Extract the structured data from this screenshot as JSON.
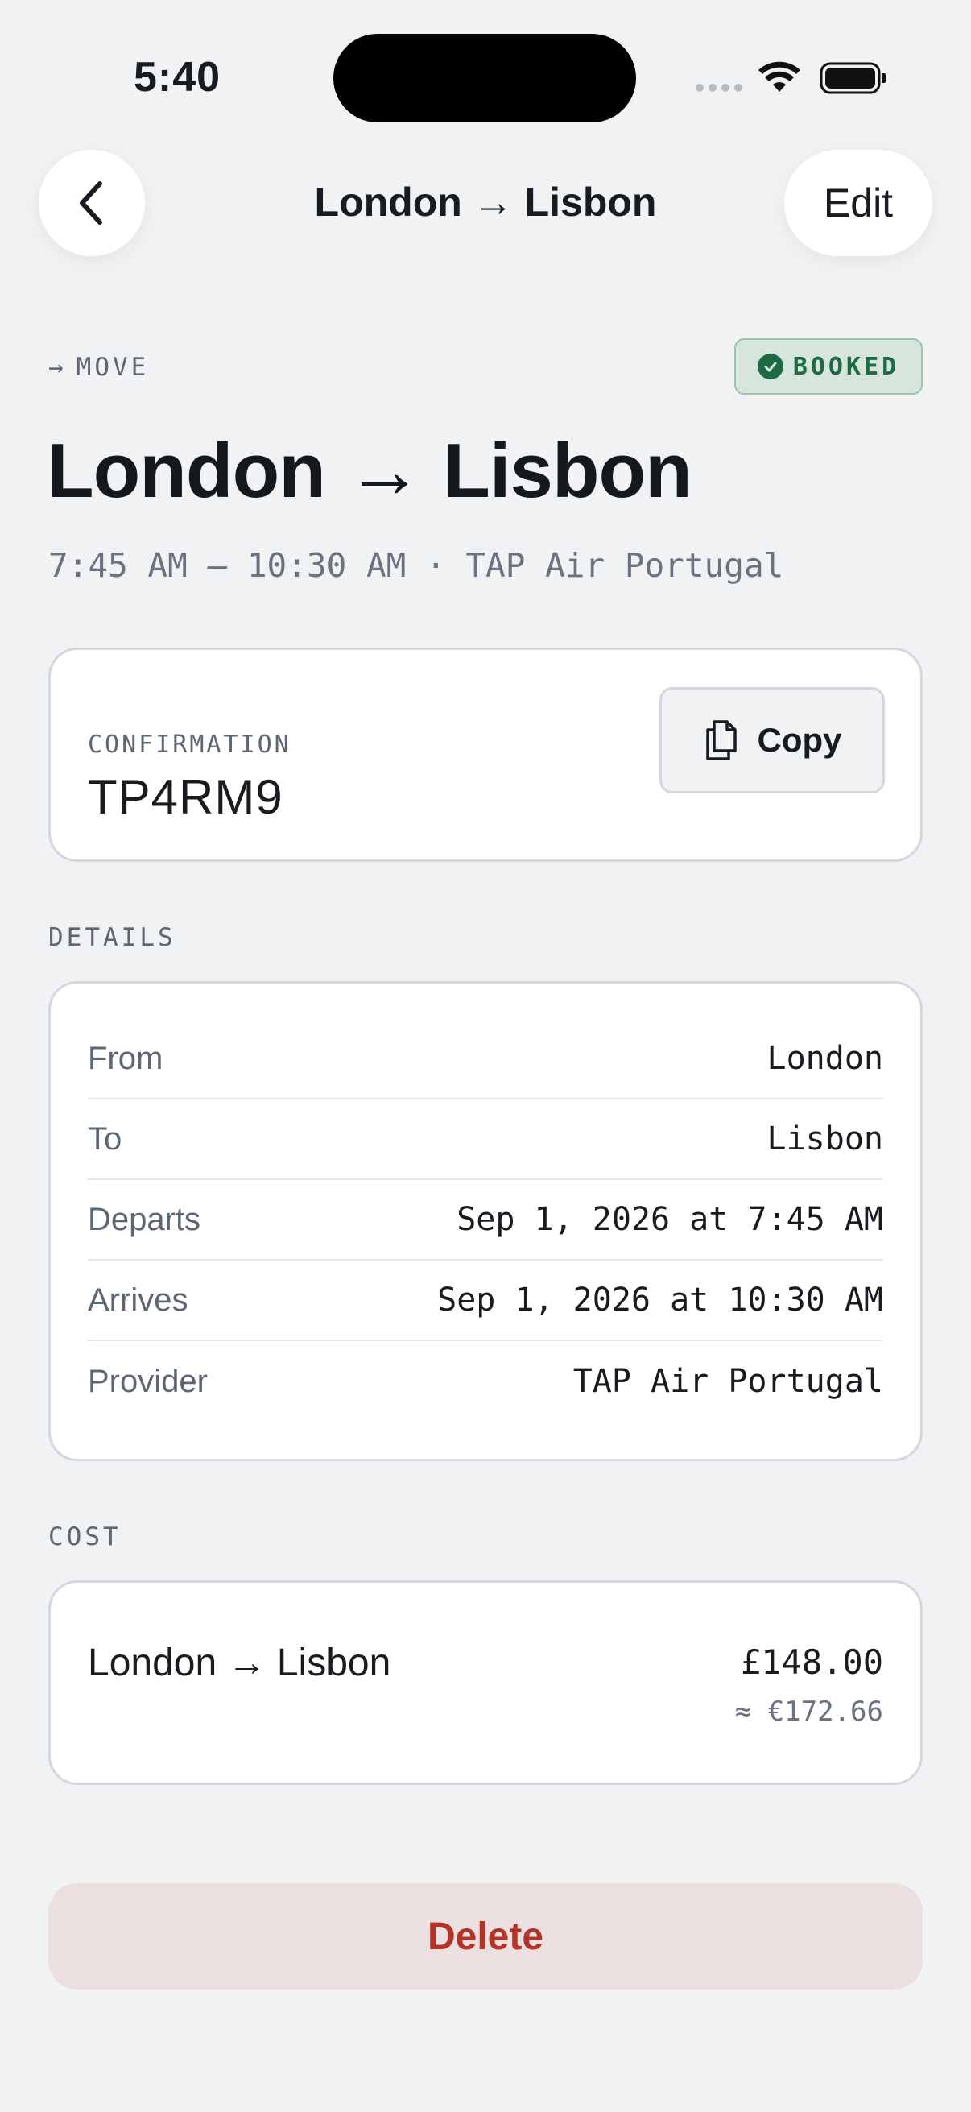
{
  "status_bar": {
    "time": "5:40"
  },
  "nav": {
    "title": "London → Lisbon",
    "edit_label": "Edit"
  },
  "header": {
    "kind_arrow": "→",
    "kind_label": "MOVE",
    "badge": "BOOKED",
    "title": "London → Lisbon",
    "subtitle": "7:45 AM — 10:30 AM · TAP Air Portugal"
  },
  "confirmation": {
    "label": "CONFIRMATION",
    "code": "TP4RM9",
    "copy_label": "Copy"
  },
  "details": {
    "section_label": "DETAILS",
    "rows": [
      {
        "label": "From",
        "value": "London"
      },
      {
        "label": "To",
        "value": "Lisbon"
      },
      {
        "label": "Departs",
        "value": "Sep 1, 2026 at 7:45 AM"
      },
      {
        "label": "Arrives",
        "value": "Sep 1, 2026 at 10:30 AM"
      },
      {
        "label": "Provider",
        "value": "TAP Air Portugal"
      }
    ]
  },
  "cost": {
    "section_label": "COST",
    "item_name": "London → Lisbon",
    "amount": "£148.00",
    "converted": "≈ €172.66"
  },
  "actions": {
    "delete_label": "Delete"
  },
  "colors": {
    "background": "#f1f2f4",
    "badge_green": "#1d6a43",
    "delete_red": "#b43328",
    "delete_bg": "#ecdfe0"
  },
  "icons": {
    "back": "chevron-left-icon",
    "copy": "copy-icon",
    "badge": "check-circle-icon",
    "wifi": "wifi-icon",
    "battery": "battery-icon"
  }
}
